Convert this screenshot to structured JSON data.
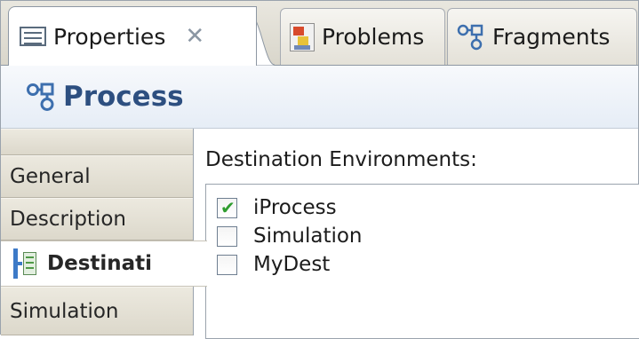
{
  "tabs": [
    {
      "label": "Properties",
      "icon": "properties-icon",
      "active": true,
      "closable": true
    },
    {
      "label": "Problems",
      "icon": "problems-icon",
      "active": false
    },
    {
      "label": "Fragments",
      "icon": "fragments-icon",
      "active": false
    }
  ],
  "close_glyph": "✕",
  "header": {
    "title": "Process",
    "icon": "process-icon",
    "title_color": "#2d4f80"
  },
  "nav": {
    "items": [
      {
        "label": "General"
      },
      {
        "label": "Description"
      },
      {
        "label": "Destinati",
        "selected": true,
        "icon": "destination-icon"
      },
      {
        "label": "Simulation"
      }
    ]
  },
  "content": {
    "label": "Destination Environments:",
    "environments": [
      {
        "label": "iProcess",
        "checked": true,
        "check_glyph": "✔"
      },
      {
        "label": "Simulation",
        "checked": false
      },
      {
        "label": "MyDest",
        "checked": false
      }
    ]
  },
  "colors": {
    "accent": "#2d4f80",
    "check": "#2f9d2f",
    "tab_bg": "#e4e1d8",
    "nav_bg": "#dcd8cb"
  }
}
